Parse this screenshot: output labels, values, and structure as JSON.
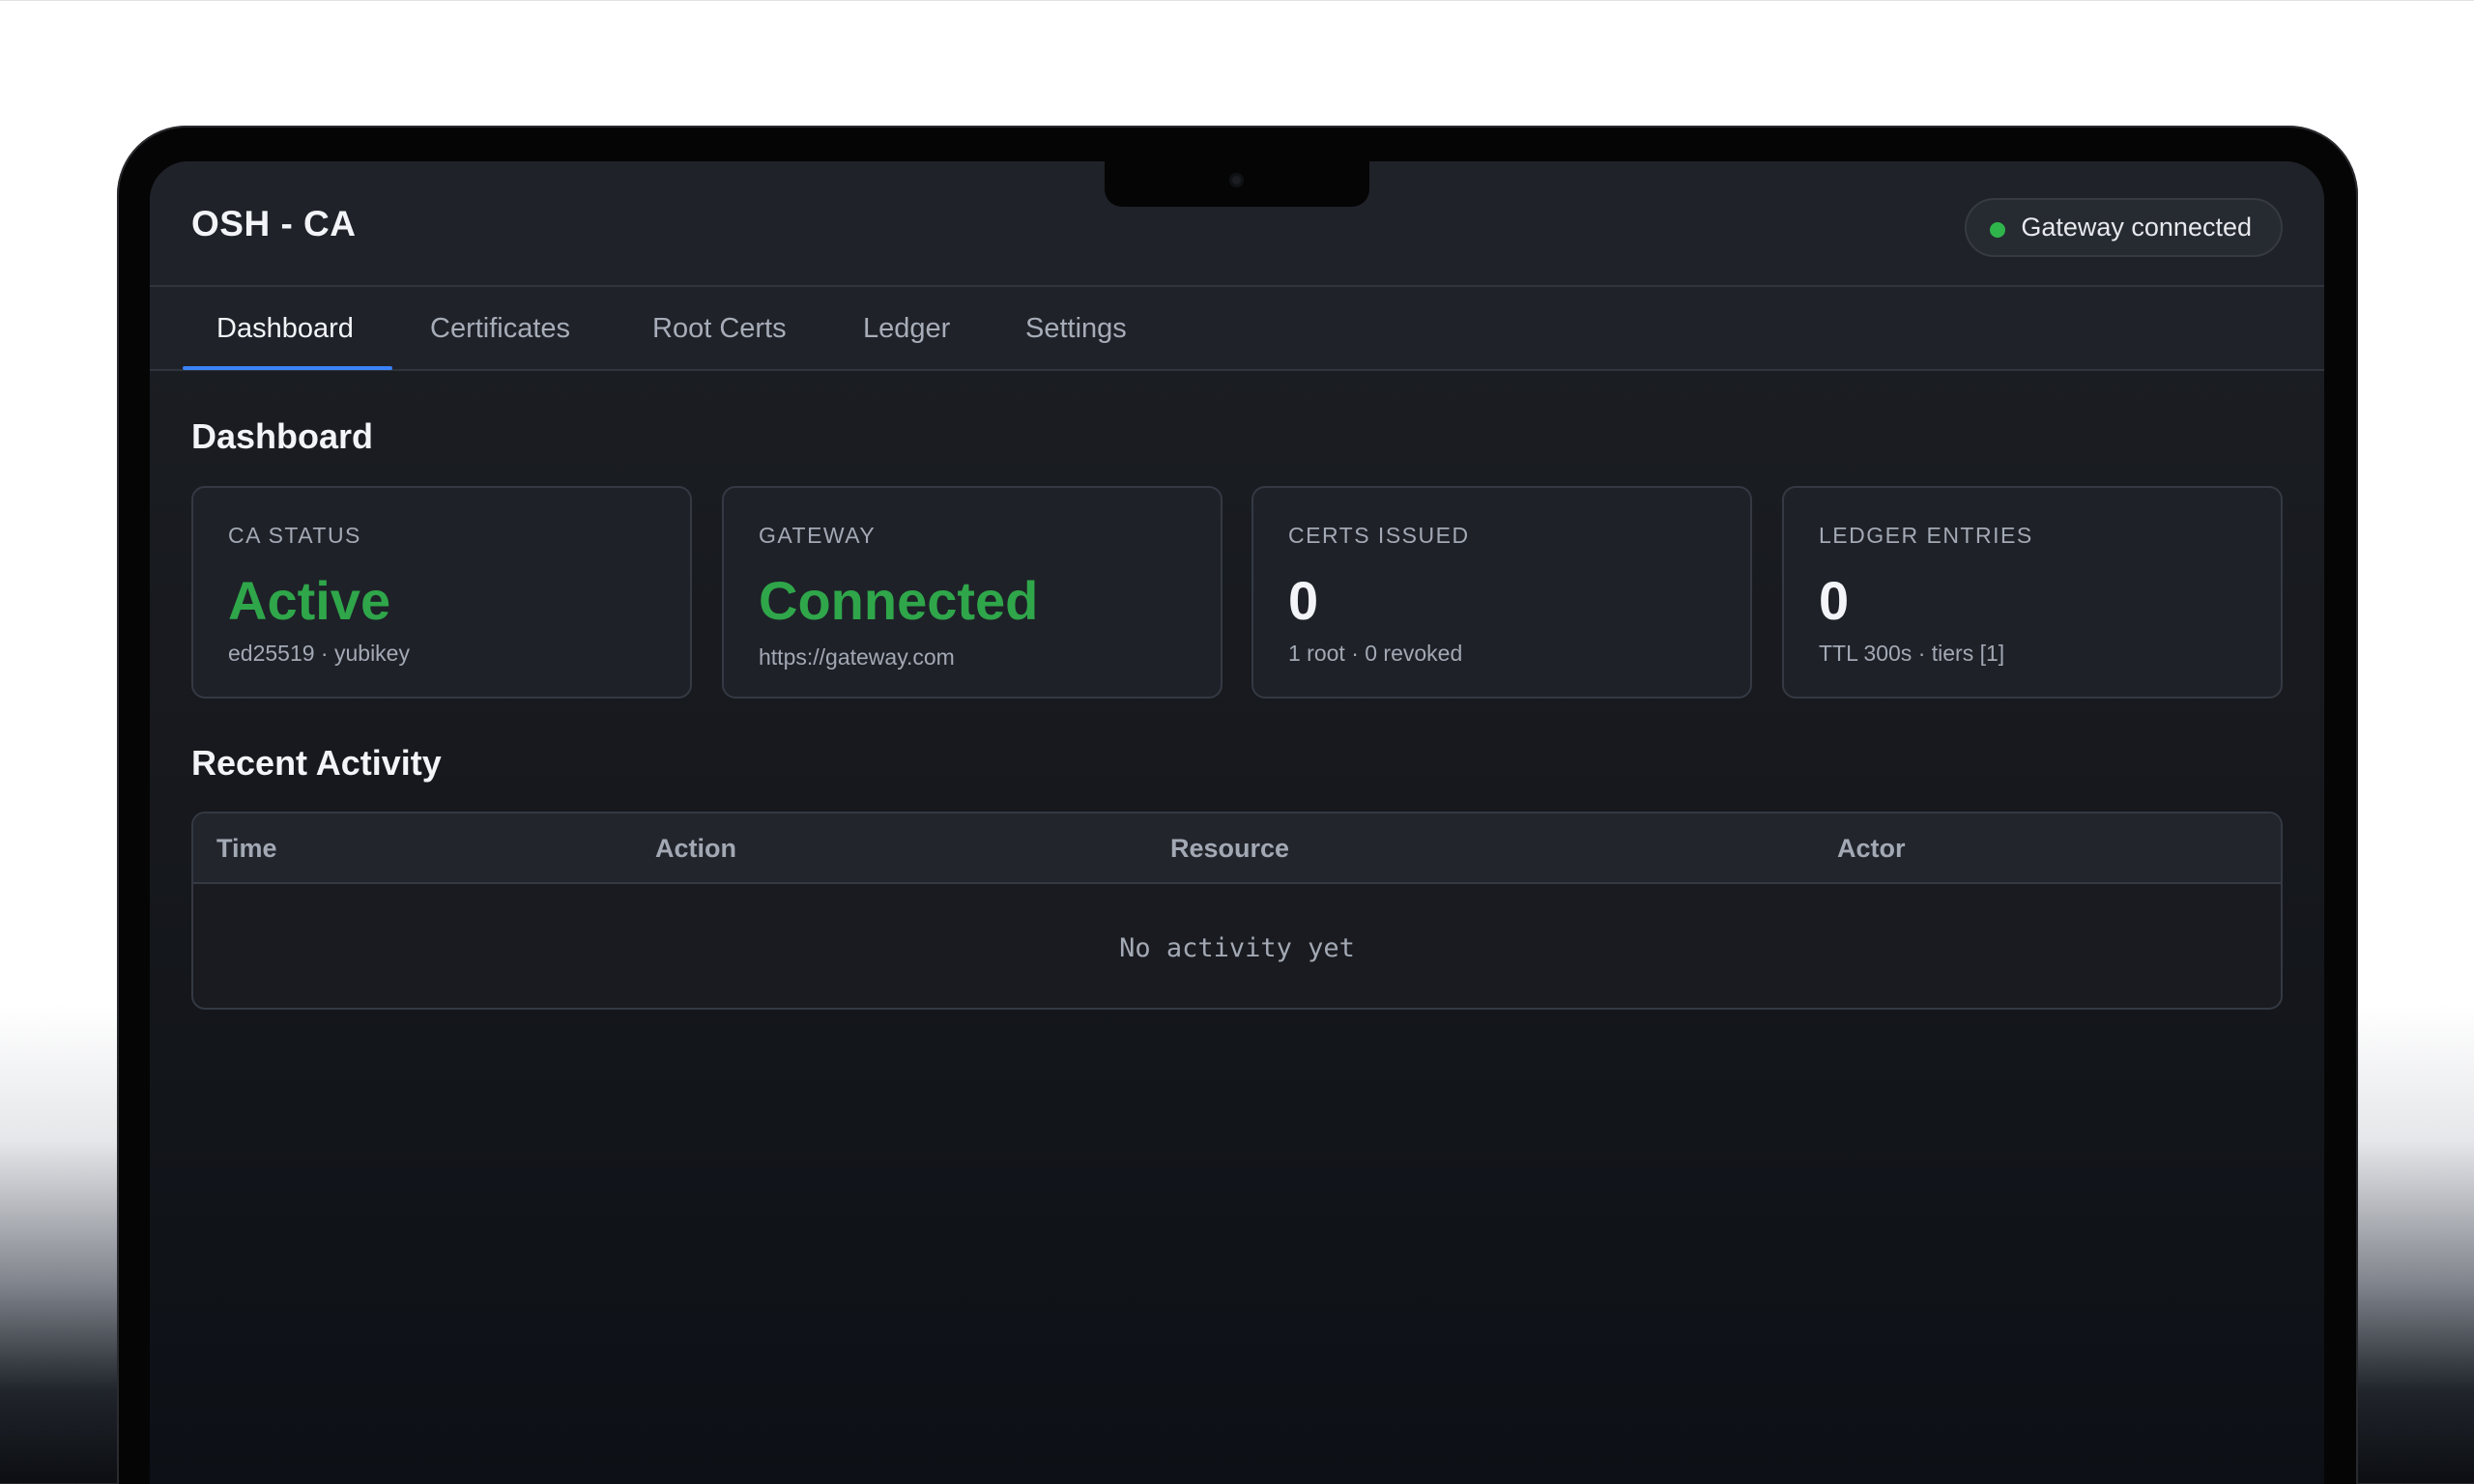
{
  "app": {
    "title": "OSH - CA",
    "gateway_status": "Gateway connected",
    "colors": {
      "accent": "#3b82f6",
      "success": "#2fa64a",
      "background": "#17191e"
    }
  },
  "tabs": [
    {
      "label": "Dashboard",
      "active": true
    },
    {
      "label": "Certificates",
      "active": false
    },
    {
      "label": "Root Certs",
      "active": false
    },
    {
      "label": "Ledger",
      "active": false
    },
    {
      "label": "Settings",
      "active": false
    }
  ],
  "dashboard": {
    "title": "Dashboard",
    "cards": [
      {
        "label": "CA STATUS",
        "value": "Active",
        "sub": "ed25519 · yubikey"
      },
      {
        "label": "GATEWAY",
        "value": "Connected",
        "sub": "https://gateway.com"
      },
      {
        "label": "CERTS ISSUED",
        "value": "0",
        "sub": "1 root · 0 revoked"
      },
      {
        "label": "LEDGER ENTRIES",
        "value": "0",
        "sub": "TTL 300s · tiers [1]"
      }
    ]
  },
  "activity": {
    "title": "Recent Activity",
    "columns": [
      "Time",
      "Action",
      "Resource",
      "Actor"
    ],
    "empty_text": "No activity yet"
  }
}
